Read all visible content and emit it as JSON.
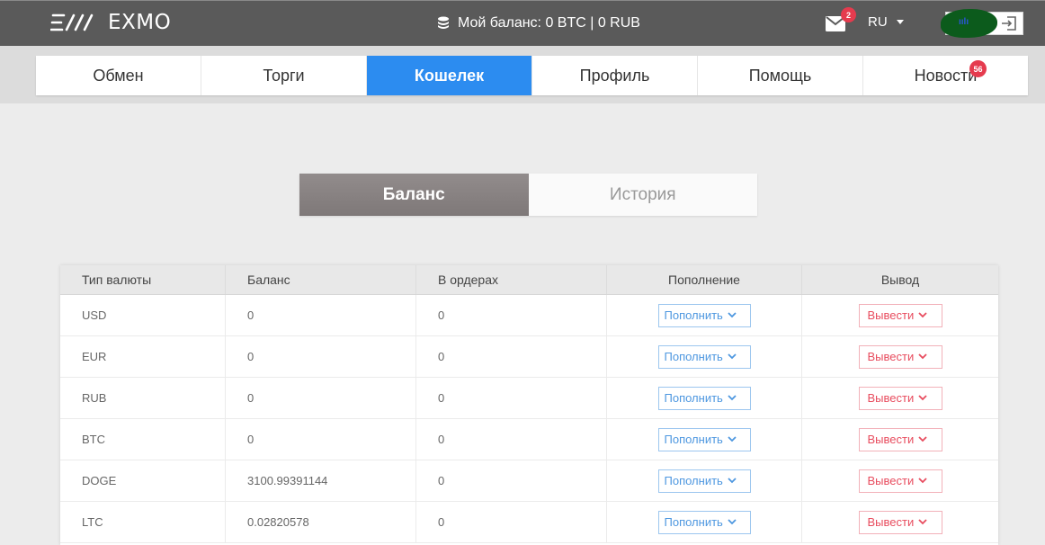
{
  "header": {
    "logo_text": "EXMO",
    "balance_text": "Мой баланс: 0 BTC | 0 RUB",
    "mail_badge": "2",
    "language": "RU",
    "brand_color": "#5a5a5a",
    "accent_color": "#2c8cf0",
    "badge_color": "#e53b4e",
    "icons": [
      "exmo-logo",
      "coins-icon",
      "mail-icon",
      "caret-down-icon",
      "logout-icon"
    ]
  },
  "nav": {
    "items": [
      {
        "label": "Обмен"
      },
      {
        "label": "Торги"
      },
      {
        "label": "Кошелек",
        "active": true
      },
      {
        "label": "Профиль"
      },
      {
        "label": "Помощь"
      },
      {
        "label": "Новости",
        "badge": "56"
      }
    ]
  },
  "tabs": {
    "balance": "Баланс",
    "history": "История",
    "active": "balance"
  },
  "table": {
    "headers": [
      "Тип валюты",
      "Баланс",
      "В ордерах",
      "Пополнение",
      "Вывод"
    ],
    "deposit_label": "Пополнить",
    "withdraw_label": "Вывести",
    "rows": [
      {
        "currency": "USD",
        "balance": "0",
        "in_orders": "0"
      },
      {
        "currency": "EUR",
        "balance": "0",
        "in_orders": "0"
      },
      {
        "currency": "RUB",
        "balance": "0",
        "in_orders": "0"
      },
      {
        "currency": "BTC",
        "balance": "0",
        "in_orders": "0"
      },
      {
        "currency": "DOGE",
        "balance": "3100.99391144",
        "in_orders": "0"
      },
      {
        "currency": "LTC",
        "balance": "0.02820578",
        "in_orders": "0"
      }
    ]
  }
}
